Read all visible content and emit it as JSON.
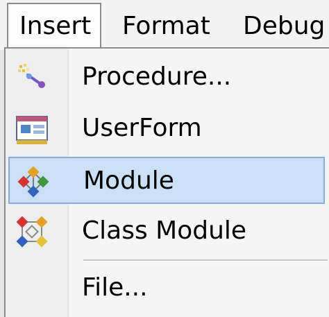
{
  "menubar": {
    "items": [
      {
        "label": "Insert",
        "active": true
      },
      {
        "label": "Format",
        "active": false
      },
      {
        "label": "Debug",
        "active": false
      }
    ]
  },
  "insert_menu": {
    "items": [
      {
        "label": "Procedure...",
        "icon": "procedure-icon",
        "highlighted": false
      },
      {
        "label": "UserForm",
        "icon": "userform-icon",
        "highlighted": false
      },
      {
        "label": "Module",
        "icon": "module-icon",
        "highlighted": true
      },
      {
        "label": "Class Module",
        "icon": "class-module-icon",
        "highlighted": false
      },
      {
        "label": "File...",
        "icon": "",
        "highlighted": false
      }
    ]
  },
  "colors": {
    "highlight_fill": "#c9e0f7",
    "highlight_border": "#84acdd",
    "menu_background": "#f5f5f5"
  }
}
